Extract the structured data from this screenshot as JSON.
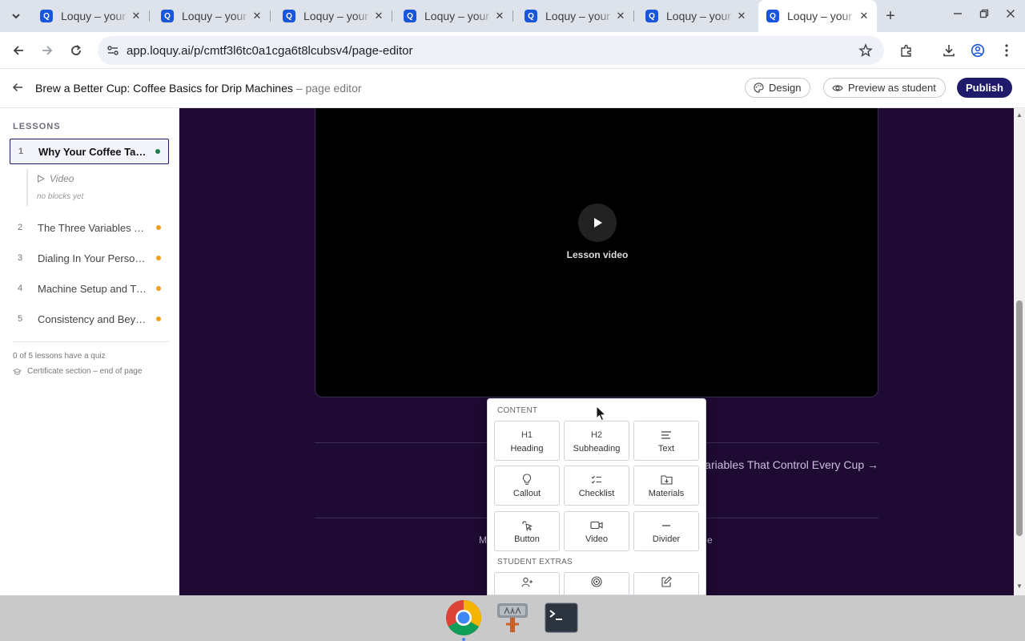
{
  "browser": {
    "tabs": [
      {
        "title": "Loquy – your"
      },
      {
        "title": "Loquy – your"
      },
      {
        "title": "Loquy – your"
      },
      {
        "title": "Loquy – your"
      },
      {
        "title": "Loquy – your"
      },
      {
        "title": "Loquy – your"
      },
      {
        "title": "Loquy – your"
      }
    ],
    "favicon_letter": "Q",
    "url": "app.loquy.ai/p/cmtf3l6tc0a1cga6t8lcubsv4/page-editor"
  },
  "header": {
    "course_title": "Brew a Better Cup: Coffee Basics for Drip Machines",
    "subtitle": " – page editor",
    "design_label": "Design",
    "preview_label": "Preview as student",
    "publish_label": "Publish"
  },
  "sidebar": {
    "section_label": "LESSONS",
    "lessons": [
      {
        "num": "1",
        "title": "Why Your Coffee Tastes Bitter",
        "status": "complete"
      },
      {
        "num": "2",
        "title": "The Three Variables That Control Every Cup",
        "status": "pending"
      },
      {
        "num": "3",
        "title": "Dialing In Your Personal Brew",
        "status": "pending"
      },
      {
        "num": "4",
        "title": "Machine Setup and Troubleshooting",
        "status": "pending"
      },
      {
        "num": "5",
        "title": "Consistency and Beyond",
        "status": "pending"
      }
    ],
    "active_subitem": "Video",
    "no_blocks": "no blocks yet",
    "quiz_note": "0 of 5 lessons have a quiz",
    "certificate_note": "Certificate section – end of page"
  },
  "canvas": {
    "video_label": "Lesson video",
    "next_link": "The Three Variables That Control Every Cup →",
    "footer_left": "M",
    "footer_right": "e"
  },
  "picker": {
    "content_label": "CONTENT",
    "blocks": [
      {
        "label": "Heading",
        "icon": "H1"
      },
      {
        "label": "Subheading",
        "icon": "H2"
      },
      {
        "label": "Text",
        "icon": "text-lines-icon"
      },
      {
        "label": "Callout",
        "icon": "lightbulb-icon"
      },
      {
        "label": "Checklist",
        "icon": "checklist-icon"
      },
      {
        "label": "Materials",
        "icon": "folder-download-icon"
      },
      {
        "label": "Button",
        "icon": "cursor-click-icon"
      },
      {
        "label": "Video",
        "icon": "video-camera-icon"
      },
      {
        "label": "Divider",
        "icon": "dash-icon"
      }
    ],
    "extras_label": "STUDENT EXTRAS"
  },
  "colors": {
    "brand": "#1f1b6b",
    "canvas_bg": "#1f0a33",
    "status_complete": "#1a7f4b",
    "status_pending": "#f29d19"
  }
}
